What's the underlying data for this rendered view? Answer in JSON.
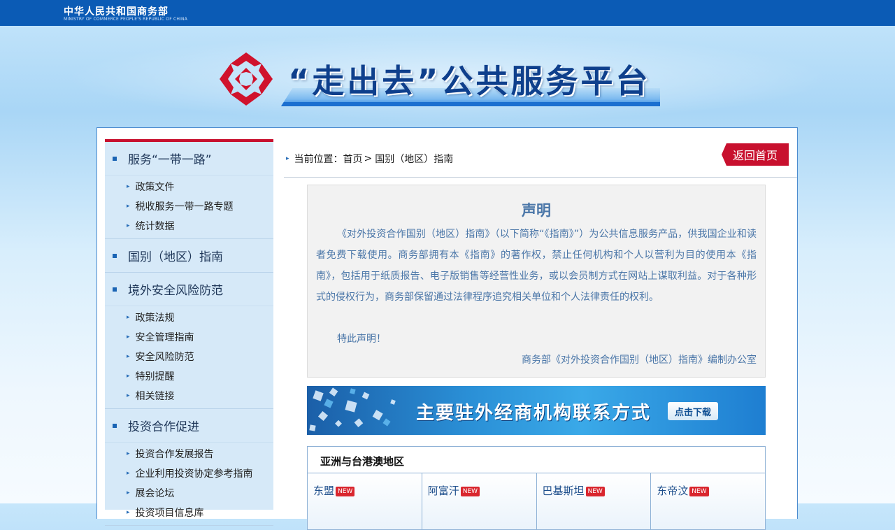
{
  "header": {
    "ministry_cn": "中华人民共和国商务部",
    "ministry_en": "MINISTRY OF COMMERCE PEOPLE'S REPUBLIC OF CHINA",
    "banner_title": "“走出去”公共服务平台",
    "brand_red": "#c8102e",
    "brand_blue": "#0b5bb5"
  },
  "sidebar": {
    "sections": [
      {
        "label": "服务“一带一路”",
        "items": [
          "政策文件",
          "税收服务一带一路专题",
          "统计数据"
        ]
      },
      {
        "label": "国别（地区）指南",
        "items": []
      },
      {
        "label": "境外安全风险防范",
        "items": [
          "政策法规",
          "安全管理指南",
          "安全风险防范",
          "特别提醒",
          "相关链接"
        ]
      },
      {
        "label": "投资合作促进",
        "items": [
          "投资合作发展报告",
          "企业利用投资协定参考指南",
          "展会论坛",
          "投资项目信息库"
        ]
      }
    ]
  },
  "breadcrumb": {
    "prefix": "当前位置：",
    "home": "首页",
    "separator": ">",
    "current": "国别（地区）指南"
  },
  "back_button": "返回首页",
  "notice": {
    "title": "声明",
    "body": "《对外投资合作国别（地区）指南》（以下简称“《指南》”）为公共信息服务产品，供我国企业和读者免费下载使用。商务部拥有本《指南》的著作权，禁止任何机构和个人以营利为目的使用本《指南》，包括用于纸质报告、电子版销售等经营性业务，或以会员制方式在网站上谋取利益。对于各种形式的侵权行为，商务部保留通过法律程序追究相关单位和个人法律责任的权利。",
    "closing": "特此声明！",
    "signature": "商务部《对外投资合作国别（地区）指南》编制办公室"
  },
  "download_banner": {
    "title": "主要驻外经商机构联系方式",
    "button": "点击下载"
  },
  "region": {
    "title": "亚洲与台港澳地区",
    "badge": "NEW",
    "countries": [
      "东盟",
      "阿富汗",
      "巴基斯坦",
      "东帝汶"
    ]
  }
}
